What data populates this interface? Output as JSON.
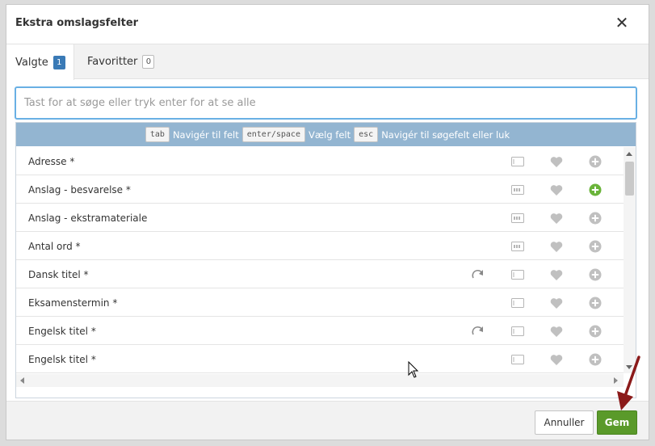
{
  "dialog": {
    "title": "Ekstra omslagsfelter",
    "close_icon": "close-icon"
  },
  "tabs": [
    {
      "label": "Valgte",
      "count": "1",
      "active": true
    },
    {
      "label": "Favoritter",
      "count": "0",
      "active": false
    }
  ],
  "search": {
    "placeholder": "Tast for at søge eller tryk enter for at se alle",
    "value": ""
  },
  "hint": {
    "k1": "tab",
    "t1": "Navigér til felt",
    "k2": "enter/space",
    "t2": "Vælg felt",
    "k3": "esc",
    "t3": "Navigér til søgefelt eller luk"
  },
  "fields": [
    {
      "label": "Adresse *",
      "icons": [
        "field-icon",
        "heart-icon",
        "add-circle-icon"
      ],
      "add_active": false
    },
    {
      "label": "Anslag - besvarelse *",
      "icons": [
        "counter-field-icon",
        "heart-icon",
        "add-circle-icon"
      ],
      "add_active": true
    },
    {
      "label": "Anslag - ekstramateriale",
      "icons": [
        "counter-field-icon",
        "heart-icon",
        "add-circle-icon"
      ],
      "add_active": false
    },
    {
      "label": "Antal ord *",
      "icons": [
        "counter-field-icon",
        "heart-icon",
        "add-circle-icon"
      ],
      "add_active": false
    },
    {
      "label": "Dansk titel *",
      "icons": [
        "redo-icon",
        "field-icon",
        "heart-icon",
        "add-circle-icon"
      ],
      "add_active": false
    },
    {
      "label": "Eksamenstermin *",
      "icons": [
        "field-icon",
        "heart-icon",
        "add-circle-icon"
      ],
      "add_active": false
    },
    {
      "label": "Engelsk titel *",
      "icons": [
        "redo-icon",
        "field-icon",
        "heart-icon",
        "add-circle-icon"
      ],
      "add_active": false
    },
    {
      "label": "Engelsk titel *",
      "icons": [
        "field-icon",
        "heart-icon",
        "add-circle-icon"
      ],
      "add_active": false
    }
  ],
  "footer": {
    "cancel_label": "Annuller",
    "save_label": "Gem"
  },
  "colors": {
    "accent": "#3a7ab6",
    "save": "#5a9a2a",
    "add_active": "#6ab43a",
    "hint_bar": "#93b5d1",
    "focus_border": "#69b0e4",
    "annotation_arrow": "#8b1a1a"
  }
}
